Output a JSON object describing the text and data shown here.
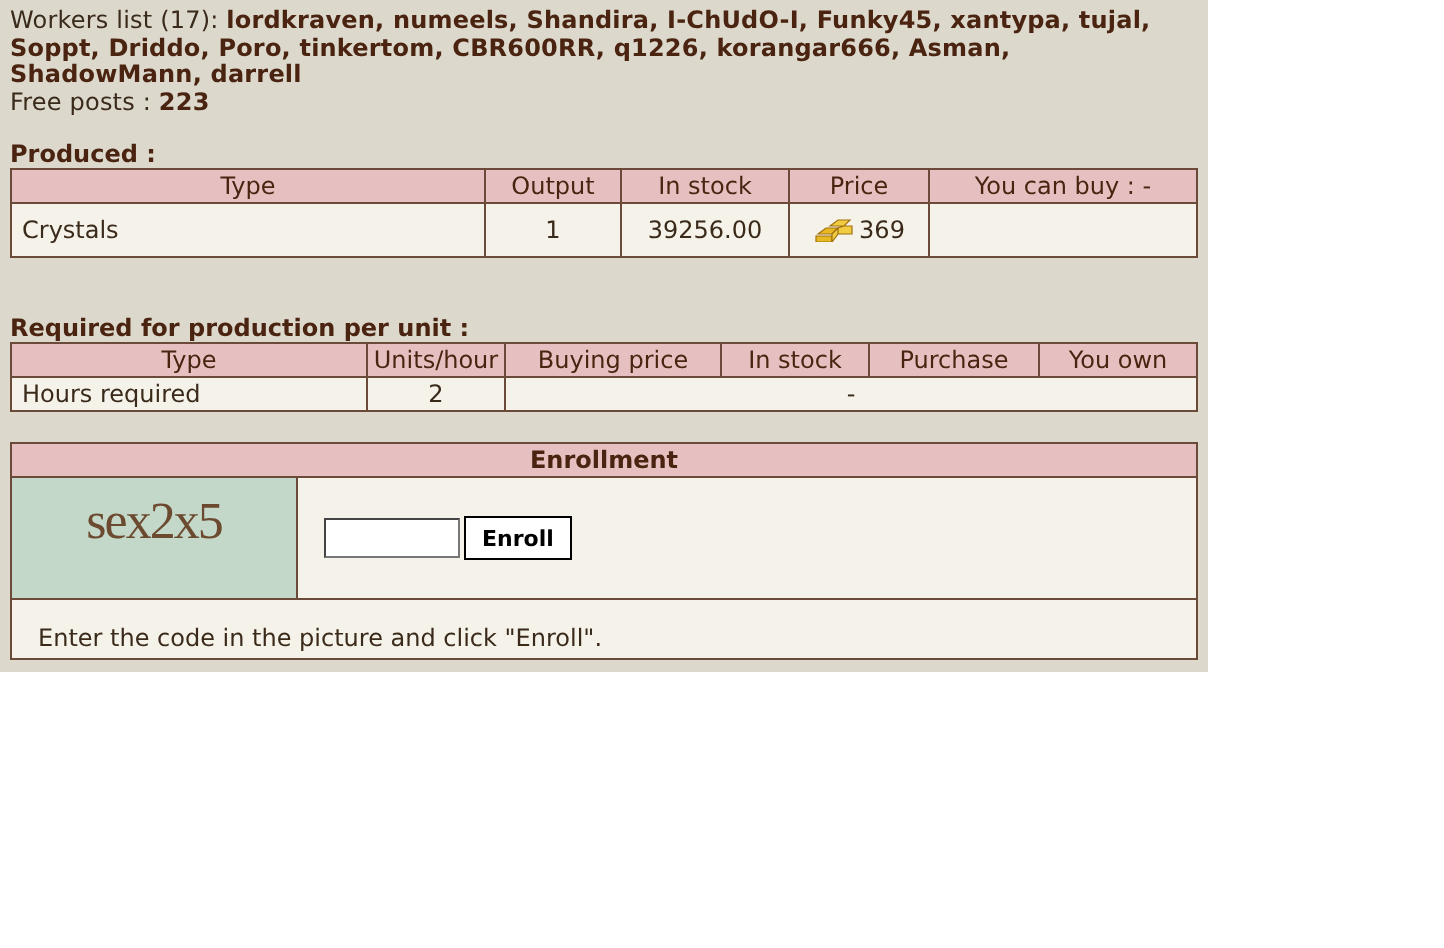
{
  "workers": "Workers list (17): **lordkraven, numeels, Shandira, I-ChUdO-I, Funky45, xantypa, tujal, Soppt, Driddo, Poro, tinkertom, CBR600RR, q1226, korangar666, Asman, ShadowMann, darrell**",
  "free_posts": "Free posts : **223**",
  "produced": {
    "title": "Produced :",
    "columns": [
      "Type",
      "Output",
      "In stock",
      "Price",
      "You can buy : -"
    ],
    "rows": [
      {
        "type": "Crystals",
        "output": "1",
        "in_stock": "39256.00",
        "price": "369",
        "you_can_buy": ""
      }
    ]
  },
  "required": {
    "title": "Required for production per unit :",
    "columns": [
      "Type",
      "Units/hour",
      "Buying price",
      "In stock",
      "Purchase",
      "You own"
    ],
    "rows": [
      {
        "type": "Hours required",
        "units": "2",
        "rest": "-"
      }
    ]
  },
  "enrollment": {
    "title": "Enrollment",
    "captcha": "sex2x5",
    "button": "Enroll",
    "hint": "Enter the code in the picture and click \"Enroll\"."
  }
}
